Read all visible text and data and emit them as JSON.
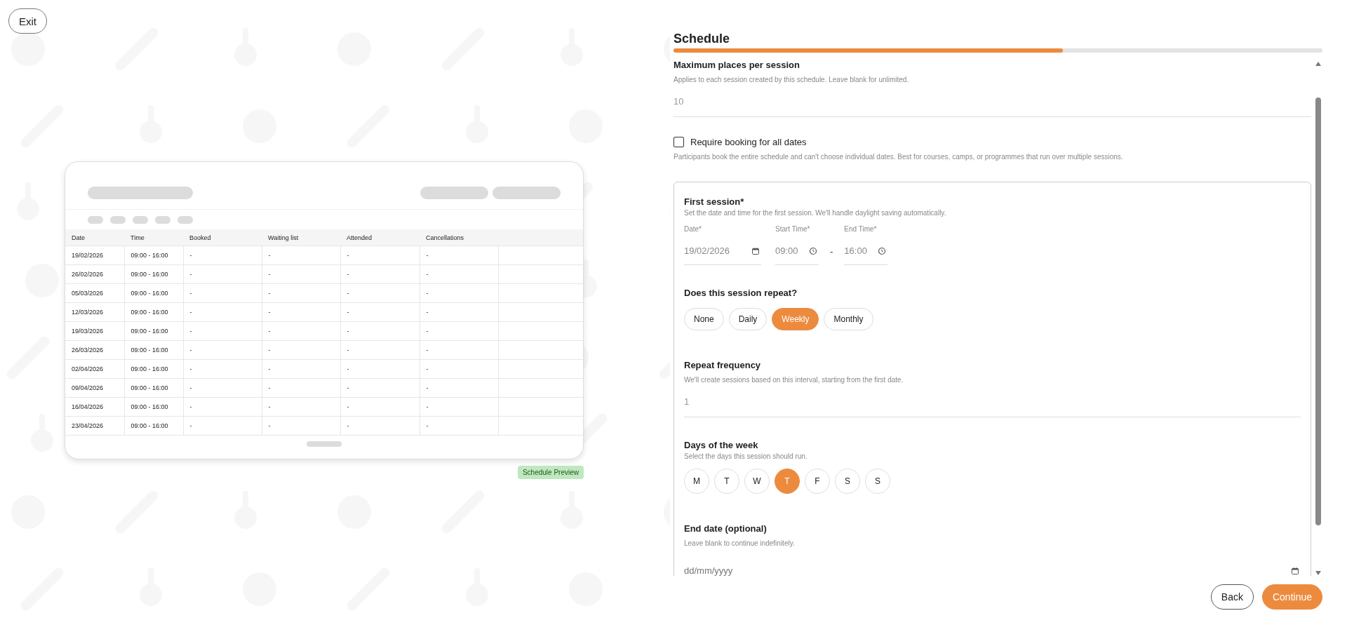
{
  "exit_button": "Exit",
  "preview": {
    "columns": [
      "Date",
      "Time",
      "Booked",
      "Waiting list",
      "Attended",
      "Cancellations"
    ],
    "rows": [
      [
        "19/02/2026",
        "09:00 - 16:00",
        "-",
        "-",
        "-",
        "-"
      ],
      [
        "26/02/2026",
        "09:00 - 16:00",
        "-",
        "-",
        "-",
        "-"
      ],
      [
        "05/03/2026",
        "09:00 - 16:00",
        "-",
        "-",
        "-",
        "-"
      ],
      [
        "12/03/2026",
        "09:00 - 16:00",
        "-",
        "-",
        "-",
        "-"
      ],
      [
        "19/03/2026",
        "09:00 - 16:00",
        "-",
        "-",
        "-",
        "-"
      ],
      [
        "26/03/2026",
        "09:00 - 16:00",
        "-",
        "-",
        "-",
        "-"
      ],
      [
        "02/04/2026",
        "09:00 - 16:00",
        "-",
        "-",
        "-",
        "-"
      ],
      [
        "09/04/2026",
        "09:00 - 16:00",
        "-",
        "-",
        "-",
        "-"
      ],
      [
        "16/04/2026",
        "09:00 - 16:00",
        "-",
        "-",
        "-",
        "-"
      ],
      [
        "23/04/2026",
        "09:00 - 16:00",
        "-",
        "-",
        "-",
        "-"
      ]
    ],
    "badge": "Schedule Preview"
  },
  "form": {
    "title": "Schedule",
    "progress": {
      "level": 0.6
    },
    "max_places": {
      "label": "Maximum places per session",
      "hint": "Applies to each session created by this schedule. Leave blank for unlimited.",
      "value": "10"
    },
    "require_booking": {
      "label": "Require booking for all dates",
      "checked": false,
      "hint": "Participants book the entire schedule and can't choose individual dates. Best for courses, camps, or programmes that run over multiple sessions."
    },
    "first_session": {
      "title": "First session*",
      "hint": "Set the date and time for the first session. We'll handle daylight saving automatically.",
      "date": {
        "label": "Date*",
        "value": "19/02/2026"
      },
      "start_time": {
        "label": "Start Time*",
        "value": "09:00"
      },
      "separator": "-",
      "end_time": {
        "label": "End Time*",
        "value": "16:00"
      }
    },
    "repeat": {
      "label": "Does this session repeat?",
      "options": [
        {
          "label": "None",
          "selected": false
        },
        {
          "label": "Daily",
          "selected": false
        },
        {
          "label": "Weekly",
          "selected": true
        },
        {
          "label": "Monthly",
          "selected": false
        }
      ]
    },
    "frequency": {
      "label": "Repeat frequency",
      "hint": "We'll create sessions based on this interval, starting from the first date.",
      "value": "1"
    },
    "days": {
      "label": "Days of the week",
      "hint": "Select the days this session should run.",
      "options": [
        {
          "label": "M",
          "selected": false
        },
        {
          "label": "T",
          "selected": false
        },
        {
          "label": "W",
          "selected": false
        },
        {
          "label": "T",
          "selected": true
        },
        {
          "label": "F",
          "selected": false
        },
        {
          "label": "S",
          "selected": false
        },
        {
          "label": "S",
          "selected": false
        }
      ]
    },
    "end_date": {
      "label": "End date (optional)",
      "hint": "Leave blank to continue indefinitely.",
      "placeholder": "dd/mm/yyyy"
    }
  },
  "buttons": [
    {
      "label": "Back",
      "kind": "secondary"
    },
    {
      "label": "Continue",
      "kind": "primary"
    }
  ]
}
